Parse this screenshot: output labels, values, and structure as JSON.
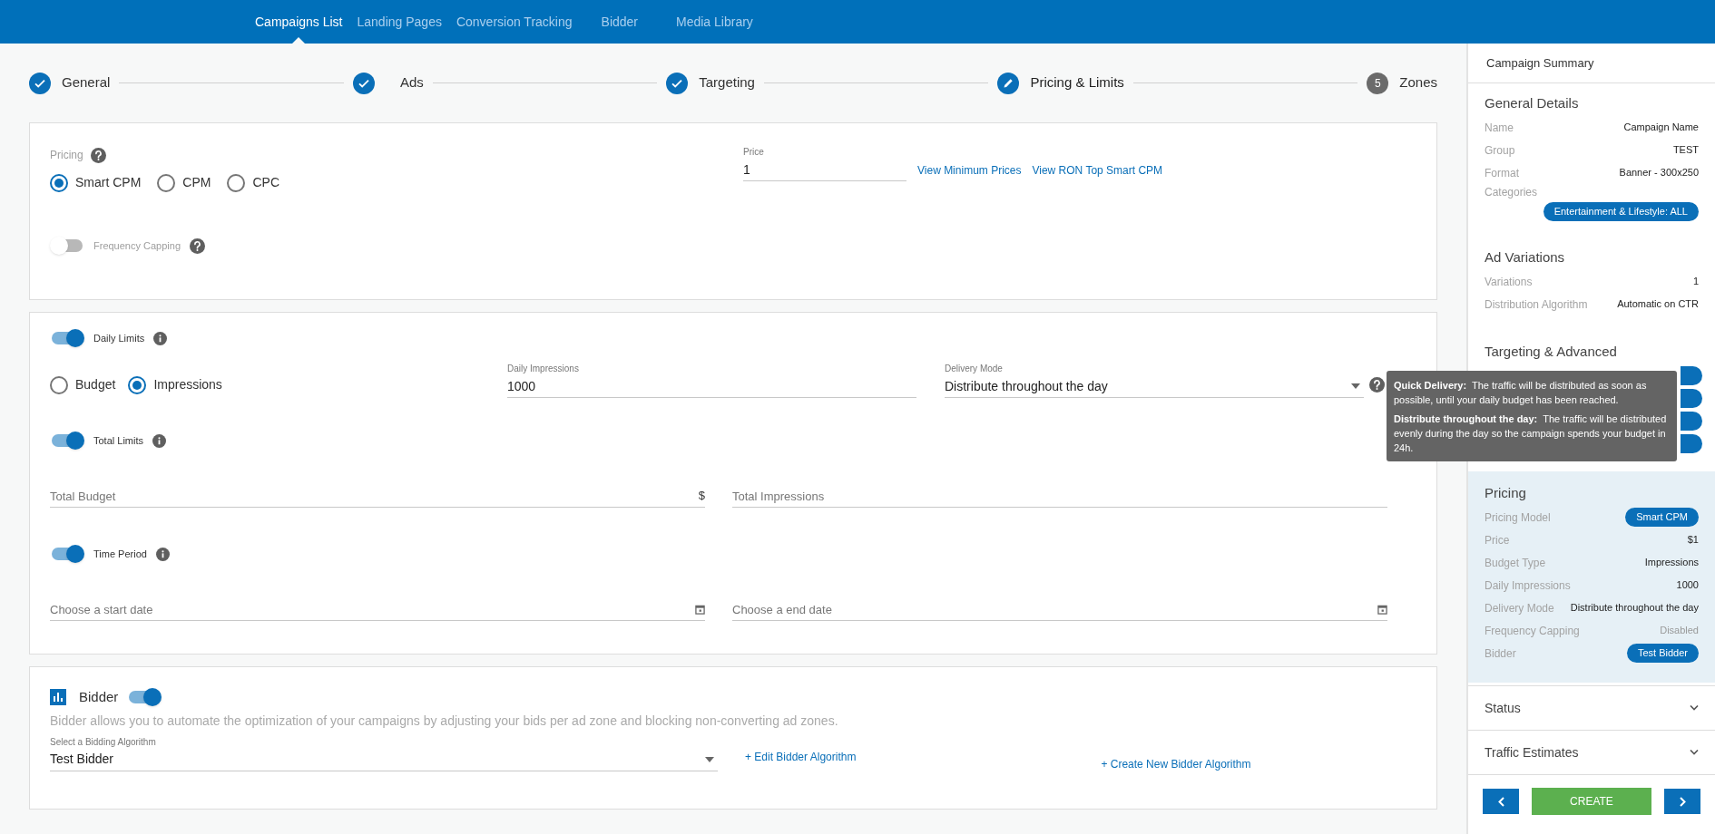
{
  "nav": [
    {
      "label": "Campaigns List",
      "selected": true
    },
    {
      "label": "Landing Pages",
      "selected": false
    },
    {
      "label": "Conversion Tracking",
      "selected": false
    },
    {
      "label": "Bidder",
      "selected": false
    },
    {
      "label": "Media Library",
      "selected": false
    }
  ],
  "steps": [
    {
      "label": "General",
      "kind": "done"
    },
    {
      "label": "Ads",
      "kind": "done"
    },
    {
      "label": "Targeting",
      "kind": "done"
    },
    {
      "label": "Pricing & Limits",
      "kind": "current"
    },
    {
      "label": "Zones",
      "kind": "pending",
      "number": "5"
    }
  ],
  "pricing_card": {
    "label": "Pricing",
    "options": [
      {
        "label": "Smart CPM",
        "selected": true
      },
      {
        "label": "CPM",
        "selected": false
      },
      {
        "label": "CPC",
        "selected": false
      }
    ],
    "price": {
      "label": "Price",
      "value": "1"
    },
    "links": [
      "View Minimum Prices",
      "View RON Top Smart CPM"
    ],
    "frequency_capping": {
      "label": "Frequency Capping",
      "on": false
    }
  },
  "limits_card": {
    "daily_limits": {
      "label": "Daily Limits",
      "on": true
    },
    "budget_types": [
      {
        "label": "Budget",
        "selected": false
      },
      {
        "label": "Impressions",
        "selected": true
      }
    ],
    "daily_impressions": {
      "label": "Daily Impressions",
      "value": "1000"
    },
    "delivery_mode": {
      "label": "Delivery Mode",
      "value": "Distribute throughout the day"
    },
    "total_limits": {
      "label": "Total Limits",
      "on": true
    },
    "total_budget": {
      "placeholder": "Total Budget",
      "suffix": "$"
    },
    "total_impressions": {
      "placeholder": "Total Impressions"
    },
    "time_period": {
      "label": "Time Period",
      "on": true
    },
    "start_date": {
      "placeholder": "Choose a start date"
    },
    "end_date": {
      "placeholder": "Choose a end date"
    }
  },
  "tooltip": [
    {
      "title": "Quick Delivery:",
      "text": "The traffic will be distributed as soon as possible, until your daily budget has been reached."
    },
    {
      "title": "Distribute throughout the day:",
      "text": "The traffic will be distributed evenly during the day so the campaign spends your budget in 24h."
    }
  ],
  "bidder_card": {
    "title": "Bidder",
    "on": true,
    "description": "Bidder allows you to automate the optimization of your campaigns by adjusting your bids per ad zone and blocking non-converting ad zones.",
    "select": {
      "label": "Select a Bidding Algorithm",
      "value": "Test Bidder"
    },
    "links": [
      "+ Edit Bidder Algorithm",
      "+ Create New Bidder Algorithm"
    ]
  },
  "summary": {
    "title": "Campaign Summary",
    "sections": [
      {
        "title": "General Details",
        "highlighted": false,
        "rows": [
          {
            "label": "Name",
            "value": "Campaign Name",
            "kind": "text"
          },
          {
            "label": "Group",
            "value": "TEST",
            "kind": "text"
          },
          {
            "label": "Format",
            "value": "Banner - 300x250",
            "kind": "text"
          },
          {
            "label": "Categories",
            "value": "Entertainment & Lifestyle: ALL",
            "kind": "wide-badge"
          }
        ]
      },
      {
        "title": "Ad Variations",
        "highlighted": false,
        "rows": [
          {
            "label": "Variations",
            "value": "1",
            "kind": "text"
          },
          {
            "label": "Distribution Algorithm",
            "value": "Automatic on CTR",
            "kind": "text"
          }
        ]
      },
      {
        "title": "Targeting & Advanced",
        "highlighted": false,
        "rows": [
          {
            "kind": "covered"
          },
          {
            "kind": "covered"
          },
          {
            "kind": "covered"
          },
          {
            "kind": "covered"
          }
        ]
      },
      {
        "title": "Pricing",
        "highlighted": true,
        "rows": [
          {
            "label": "Pricing Model",
            "value": "Smart CPM",
            "kind": "badge"
          },
          {
            "label": "Price",
            "value": "$1",
            "kind": "text"
          },
          {
            "label": "Budget Type",
            "value": "Impressions",
            "kind": "text"
          },
          {
            "label": "Daily Impressions",
            "value": "1000",
            "kind": "text"
          },
          {
            "label": "Delivery Mode",
            "value": "Distribute throughout the day",
            "kind": "text"
          },
          {
            "label": "Frequency Capping",
            "value": "Disabled",
            "kind": "muted"
          },
          {
            "label": "Bidder",
            "value": "Test Bidder",
            "kind": "badge"
          }
        ]
      }
    ],
    "collapsibles": [
      {
        "label": "Status",
        "expanded": false
      },
      {
        "label": "Traffic Estimates",
        "expanded": false
      }
    ],
    "create_button": "CREATE"
  }
}
